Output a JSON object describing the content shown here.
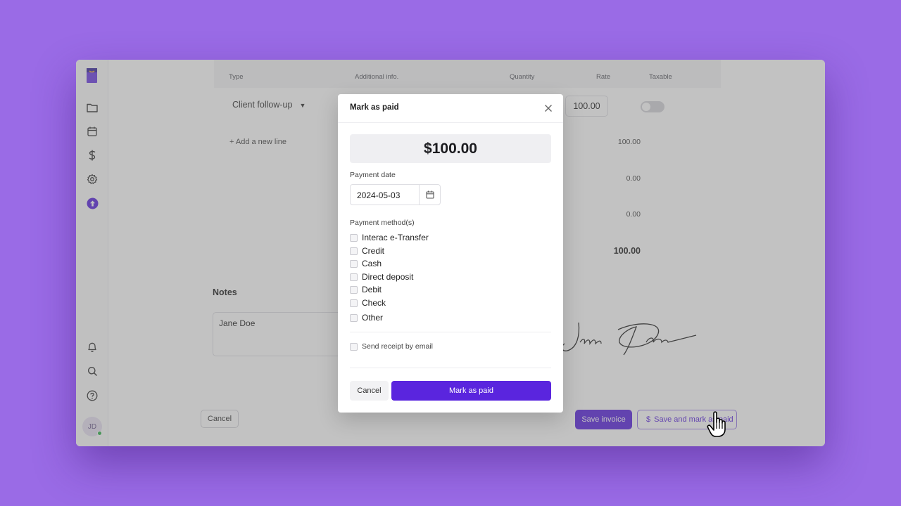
{
  "colors": {
    "background": "#9a6be6",
    "accent": "#5a25de",
    "online": "#2fb14b"
  },
  "sidebar": {
    "items": [
      {
        "icon": "folder-icon"
      },
      {
        "icon": "calendar-icon"
      },
      {
        "icon": "dollar-icon"
      },
      {
        "icon": "gear-icon"
      },
      {
        "icon": "upgrade-icon"
      }
    ],
    "bottom_items": [
      {
        "icon": "bell-icon"
      },
      {
        "icon": "search-icon"
      },
      {
        "icon": "help-icon"
      }
    ],
    "avatar_initials": "JD"
  },
  "invoice": {
    "columns": [
      "Type",
      "Additional info.",
      "Quantity",
      "Rate",
      "Taxable"
    ],
    "line": {
      "type": "Client follow-up",
      "rate": "100.00",
      "taxable": false
    },
    "add_line": "+ Add a new line",
    "summary": [
      "100.00",
      "0.00",
      "0.00"
    ],
    "total": "100.00",
    "notes_title": "Notes",
    "notes_value": "Jane Doe",
    "signature": "Jane Doe"
  },
  "footer": {
    "cancel": "Cancel",
    "save_invoice": "Save invoice",
    "save_mark": "Save and mark as paid",
    "save_mark_icon": "$"
  },
  "modal": {
    "title": "Mark as paid",
    "amount": "$100.00",
    "payment_date_label": "Payment date",
    "payment_date": "2024-05-03",
    "methods_label": "Payment method(s)",
    "methods": [
      "Interac e-Transfer",
      "Credit",
      "Cash",
      "Direct deposit",
      "Debit",
      "Check",
      "Other"
    ],
    "send_receipt": "Send receipt by email",
    "cancel": "Cancel",
    "confirm": "Mark as paid"
  }
}
